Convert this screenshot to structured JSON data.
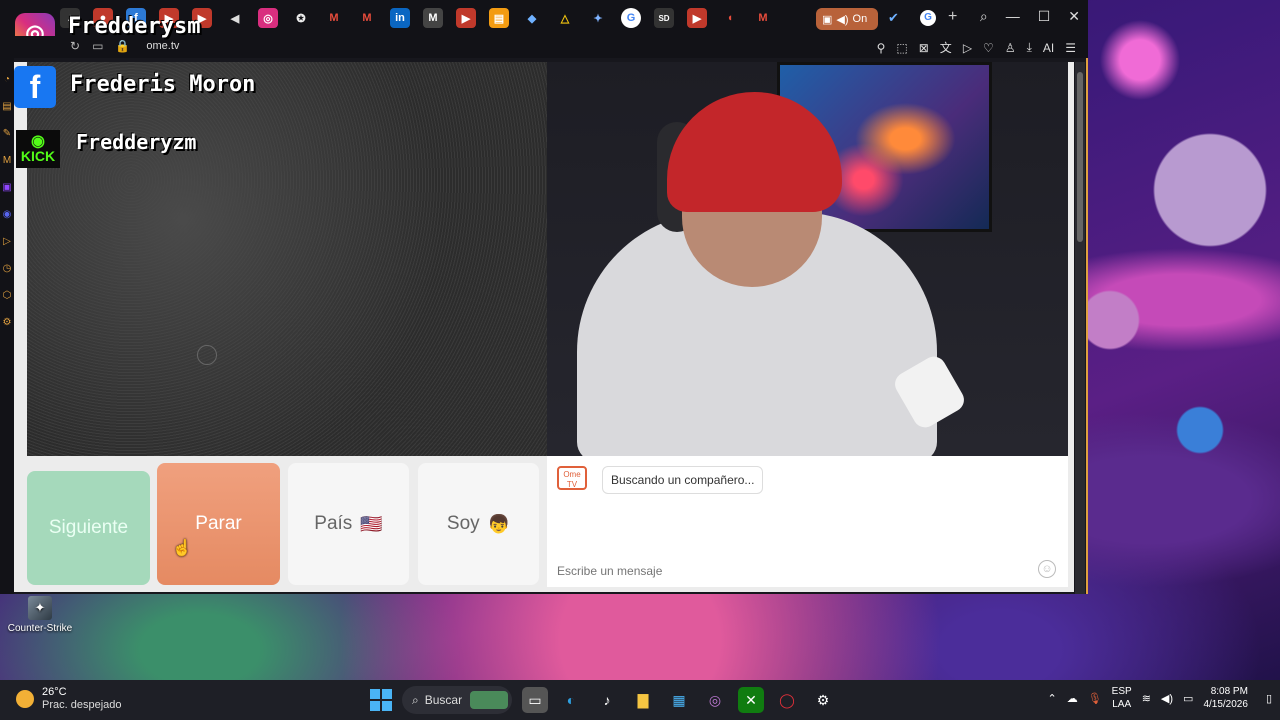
{
  "browser": {
    "url": "ome.tv",
    "active_tab_label": "On",
    "tab_icons": [
      "instagram-icon",
      "tiktok-icon",
      "facebook-icon",
      "youtube-icon",
      "youtube-icon",
      "speaker-icon",
      "instagram-icon",
      "steam-icon",
      "gmail-icon",
      "gmail-icon",
      "linkedin-icon",
      "medium-icon",
      "youtube-icon",
      "slides-icon",
      "pin-icon",
      "drive-icon",
      "gemini-icon",
      "google-icon",
      "sd-icon",
      "youtube-icon",
      "opera-icon",
      "gmail-icon"
    ],
    "toolbar_ai": "AI"
  },
  "overlay": {
    "brand_name": "Fredderysm",
    "facebook_name": "Frederis Moron",
    "kick_name": "Fredderyzm",
    "kick_logo_text": "KICK"
  },
  "controls": {
    "next_label": "Siguiente",
    "stop_label": "Parar",
    "country_label": "País",
    "country_flag": "🇺🇸",
    "gender_label": "Soy",
    "gender_emoji": "👦"
  },
  "chat": {
    "logo_text": "Ome TV",
    "status_message": "Buscando un compañero...",
    "input_placeholder": "Escribe un mensaje"
  },
  "desktop": {
    "icon_label": "Counter-Strike"
  },
  "taskbar": {
    "temperature": "26°C",
    "weather_desc": "Prac. despejado",
    "search_label": "Buscar",
    "lang_primary": "ESP",
    "lang_secondary": "LAA",
    "time": "8:08 PM",
    "date": "4/15/2026"
  },
  "colors": {
    "accent_stop": "#e58a62",
    "accent_next": "#a5d9bb",
    "browser_accent": "#e0a040"
  }
}
